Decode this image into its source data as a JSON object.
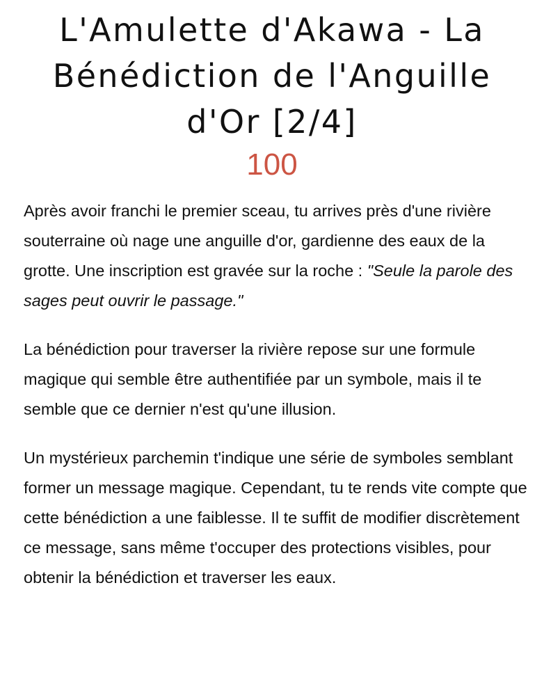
{
  "challenge": {
    "title": "L'Amulette d'Akawa - La Bénédiction de l'Anguille d'Or [2/4]",
    "points": "100",
    "paragraphs": [
      {
        "text": "Après avoir franchi le premier sceau, tu arrives près d'une rivière souterraine où nage une anguille d'or, gardienne des eaux de la grotte. Une inscription est gravée sur la roche : ",
        "quote": "\"Seule la parole des sages peut ouvrir le passage.\""
      },
      {
        "text": "La bénédiction pour traverser la rivière repose sur une formule magique qui semble être authentifiée par un symbole, mais il te semble que ce dernier n'est qu'une illusion."
      },
      {
        "text": "Un mystérieux parchemin t'indique une série de symboles semblant former un message magique. Cependant, tu te rends vite compte que cette bénédiction a une faiblesse. Il te suffit de modifier discrètement ce message, sans même t'occuper des protections visibles, pour obtenir la bénédiction et traverser les eaux."
      }
    ]
  },
  "colors": {
    "points": "#cc5544",
    "text": "#111111",
    "background": "#ffffff"
  }
}
